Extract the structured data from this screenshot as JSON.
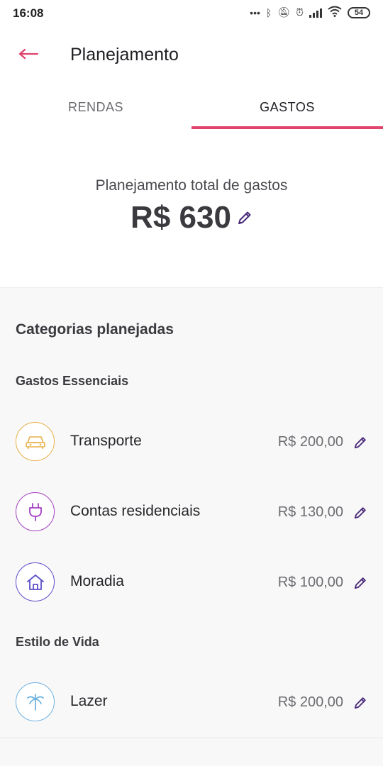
{
  "status_bar": {
    "time": "16:08",
    "battery": "54"
  },
  "app_bar": {
    "title": "Planejamento"
  },
  "tabs": [
    {
      "label": "RENDAS",
      "selected": false
    },
    {
      "label": "GASTOS",
      "selected": true
    }
  ],
  "summary": {
    "label": "Planejamento total de gastos",
    "value": "R$ 630"
  },
  "categories": {
    "title": "Categorias planejadas",
    "groups": [
      {
        "title": "Gastos Essenciais",
        "items": [
          {
            "label": "Transporte",
            "value": "R$ 200,00",
            "icon": "car-icon",
            "color": "#e8b04a"
          },
          {
            "label": "Contas residenciais",
            "value": "R$ 130,00",
            "icon": "plug-icon",
            "color": "#a43fc2"
          },
          {
            "label": "Moradia",
            "value": "R$ 100,00",
            "icon": "house-icon",
            "color": "#5b4fc9"
          }
        ]
      },
      {
        "title": "Estilo de Vida",
        "items": [
          {
            "label": "Lazer",
            "value": "R$ 200,00",
            "icon": "palm-tree-icon",
            "color": "#6fb3e0"
          }
        ]
      }
    ]
  },
  "colors": {
    "accent": "#e0436b",
    "edit_icon": "#4a2a7a"
  }
}
